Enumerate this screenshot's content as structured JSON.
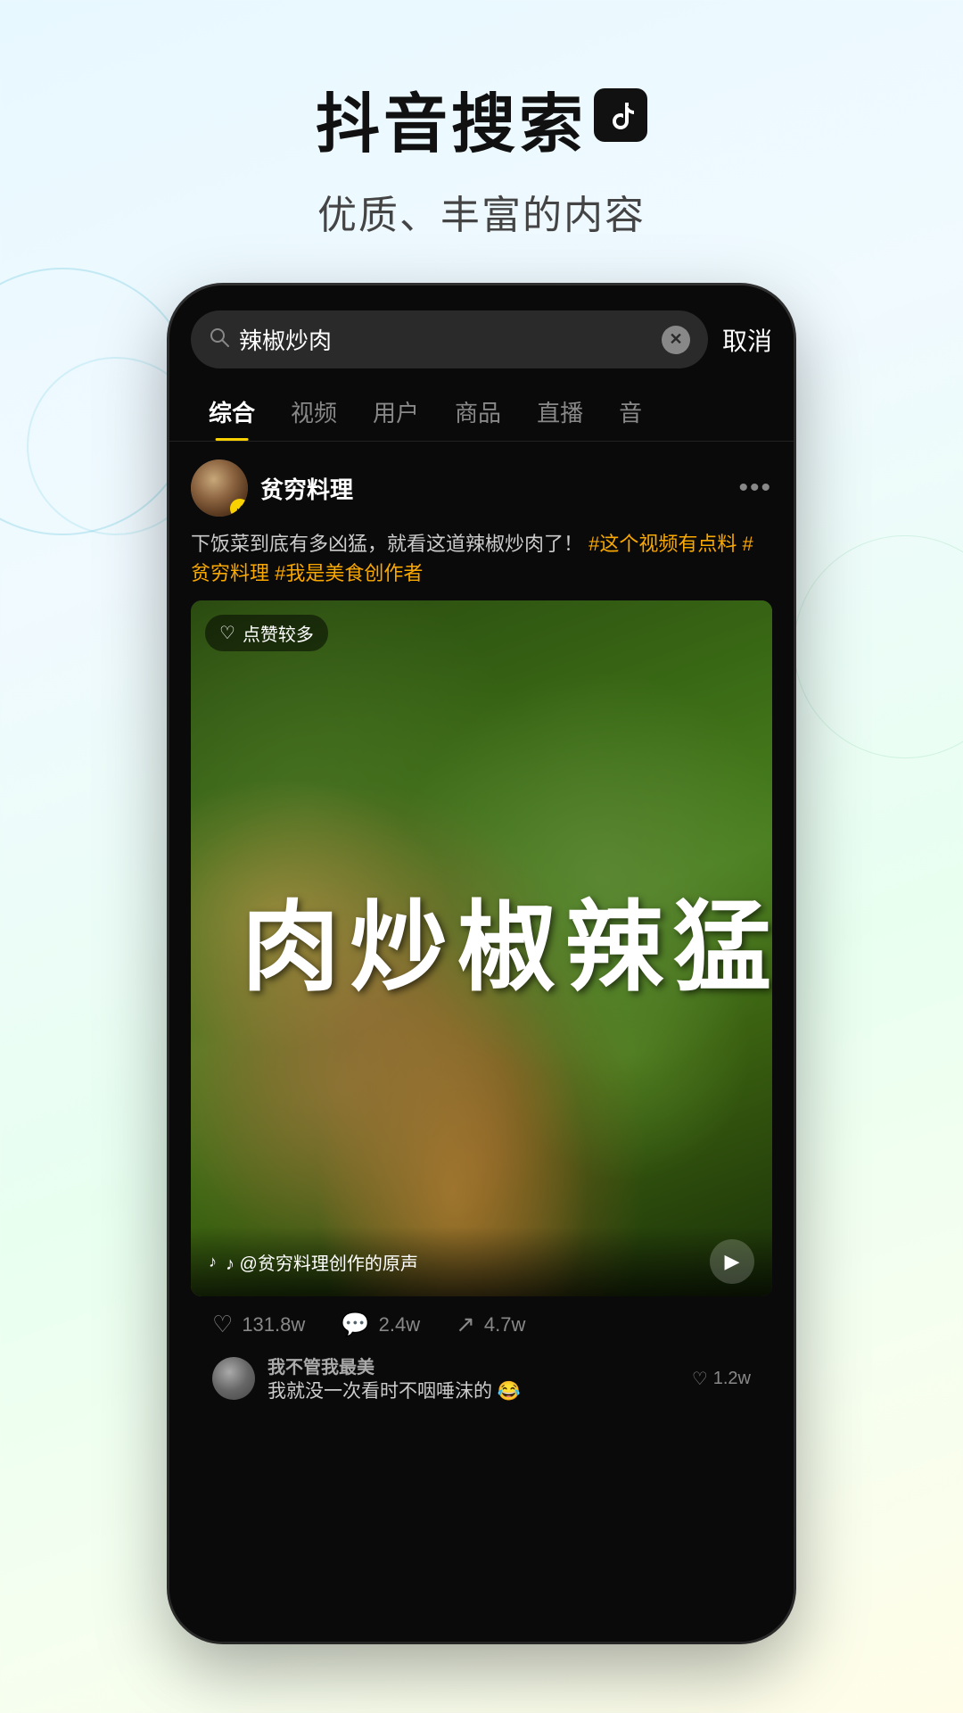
{
  "header": {
    "main_title": "抖音搜索",
    "tiktok_logo": "♪",
    "sub_title": "优质、丰富的内容"
  },
  "phone": {
    "search": {
      "placeholder": "辣椒炒肉",
      "cancel_label": "取消"
    },
    "tabs": [
      {
        "label": "综合",
        "active": true
      },
      {
        "label": "视频",
        "active": false
      },
      {
        "label": "用户",
        "active": false
      },
      {
        "label": "商品",
        "active": false
      },
      {
        "label": "直播",
        "active": false
      },
      {
        "label": "音",
        "active": false
      }
    ],
    "post": {
      "author_name": "贫穷料理",
      "description": "下饭菜到底有多凶猛，就看这道辣椒炒肉了！",
      "hashtags": "#这个视频有点料 #贫穷料理 #我是美食创作者",
      "likes_badge": "点赞较多",
      "video_text": "勇猛辣椒炒肉",
      "audio_label": "♪ @贫穷料理创作的原声",
      "stats": {
        "likes": "131.8w",
        "comments": "2.4w",
        "shares": "4.7w"
      }
    },
    "comments": [
      {
        "username": "我不管我最美",
        "text": "我就没一次看时不咽唾沫的 😂",
        "likes": "1.2w"
      }
    ]
  }
}
